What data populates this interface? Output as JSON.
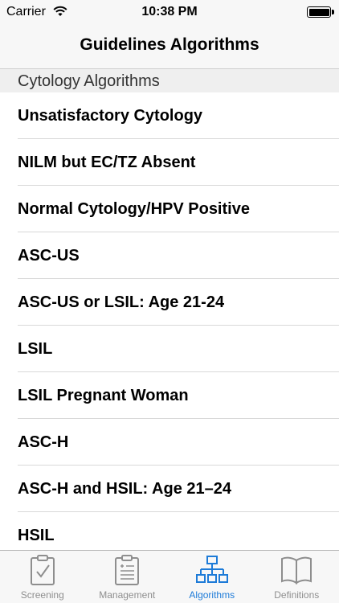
{
  "status_bar": {
    "carrier": "Carrier",
    "time": "10:38 PM"
  },
  "nav": {
    "title": "Guidelines Algorithms"
  },
  "list": {
    "section_header": "Cytology Algorithms",
    "items": [
      "Unsatisfactory Cytology",
      "NILM but EC/TZ Absent",
      "Normal Cytology/HPV Positive",
      "ASC-US",
      "ASC-US or LSIL: Age 21-24",
      "LSIL",
      "LSIL Pregnant Woman",
      "ASC-H",
      "ASC-H and HSIL: Age 21–24",
      "HSIL"
    ]
  },
  "tab_bar": {
    "tabs": [
      {
        "label": "Screening",
        "icon": "clipboard-check-icon"
      },
      {
        "label": "Management",
        "icon": "clipboard-list-icon"
      },
      {
        "label": "Algorithms",
        "icon": "flowchart-icon"
      },
      {
        "label": "Definitions",
        "icon": "book-icon"
      }
    ],
    "active_index": 2
  },
  "colors": {
    "accent": "#1d7bd8",
    "inactive": "#8e8e8e",
    "bar_background": "#f7f7f7"
  }
}
